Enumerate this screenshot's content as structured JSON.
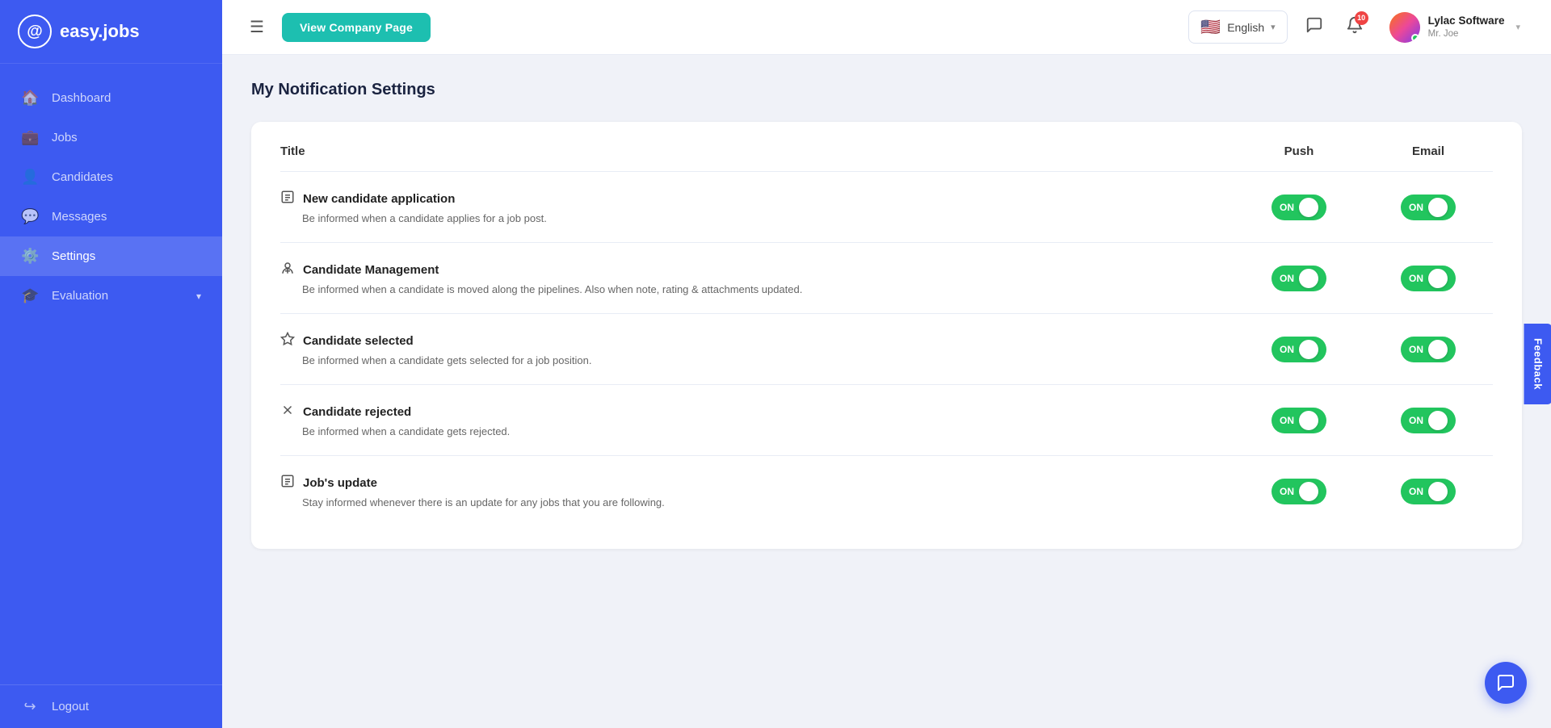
{
  "sidebar": {
    "logo_text": "easy.jobs",
    "items": [
      {
        "id": "dashboard",
        "label": "Dashboard",
        "icon": "🏠"
      },
      {
        "id": "jobs",
        "label": "Jobs",
        "icon": "💼"
      },
      {
        "id": "candidates",
        "label": "Candidates",
        "icon": "👤"
      },
      {
        "id": "messages",
        "label": "Messages",
        "icon": "💬"
      },
      {
        "id": "settings",
        "label": "Settings",
        "icon": "⚙️",
        "active": true
      },
      {
        "id": "evaluation",
        "label": "Evaluation",
        "icon": "🎓",
        "has_chevron": true
      }
    ],
    "logout_label": "Logout"
  },
  "header": {
    "view_company_btn": "View Company Page",
    "language": "English",
    "notification_count": "10",
    "user_name": "Lylac Software",
    "user_sub": "Mr. Joe"
  },
  "page": {
    "title": "My Notification Settings",
    "table_headers": {
      "title": "Title",
      "push": "Push",
      "email": "Email"
    },
    "notifications": [
      {
        "id": "new-candidate-application",
        "icon": "📋",
        "title": "New candidate application",
        "description": "Be informed when a candidate applies for a job post.",
        "push": true,
        "email": true
      },
      {
        "id": "candidate-management",
        "icon": "📌",
        "title": "Candidate Management",
        "description": "Be informed when a candidate is moved along the pipelines. Also when note, rating & attachments updated.",
        "push": true,
        "email": true
      },
      {
        "id": "candidate-selected",
        "icon": "🏆",
        "title": "Candidate selected",
        "description": "Be informed when a candidate gets selected for a job position.",
        "push": true,
        "email": true
      },
      {
        "id": "candidate-rejected",
        "icon": "✕",
        "title": "Candidate rejected",
        "description": "Be informed when a candidate gets rejected.",
        "push": true,
        "email": true
      },
      {
        "id": "jobs-update",
        "icon": "📋",
        "title": "Job's update",
        "description": "Stay informed whenever there is an update for any jobs that you are following.",
        "push": true,
        "email": true
      }
    ]
  },
  "feedback": {
    "label": "Feedback"
  },
  "chat_icon": "💬"
}
